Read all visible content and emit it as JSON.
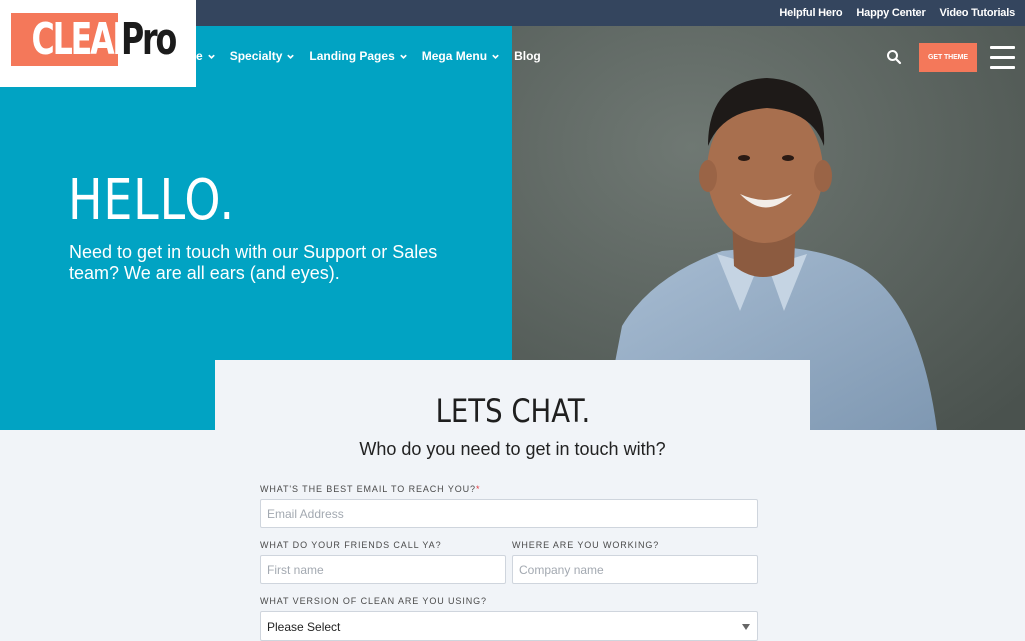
{
  "topbar": {
    "links": [
      "Helpful Hero",
      "Happy Center",
      "Video Tutorials"
    ]
  },
  "logo": {
    "part1": "CLEAN",
    "part2": "Pro"
  },
  "nav": {
    "items": [
      {
        "label": "e",
        "has_dropdown": true
      },
      {
        "label": "Specialty",
        "has_dropdown": true
      },
      {
        "label": "Landing Pages",
        "has_dropdown": true
      },
      {
        "label": "Mega Menu",
        "has_dropdown": true
      },
      {
        "label": "Blog",
        "has_dropdown": false
      }
    ],
    "cta_label": "GET THEME"
  },
  "hero": {
    "title": "HELLO.",
    "text": "Need to get in touch with our Support or Sales team? We are all ears (and eyes)."
  },
  "form": {
    "title": "LETS CHAT.",
    "subtitle": "Who do you need to get in touch with?",
    "email_label": "WHAT'S THE BEST EMAIL TO REACH YOU?",
    "required_mark": "*",
    "email_placeholder": "Email Address",
    "name_label": "WHAT DO YOUR FRIENDS CALL YA?",
    "name_placeholder": "First name",
    "company_label": "WHERE ARE YOU WORKING?",
    "company_placeholder": "Company name",
    "version_label": "WHAT VERSION OF CLEAN ARE YOU USING?",
    "version_value": "Please Select"
  },
  "colors": {
    "topbar": "#34455e",
    "hero": "#01a3c3",
    "accent": "#f4785a",
    "background": "#f1f4f8"
  }
}
